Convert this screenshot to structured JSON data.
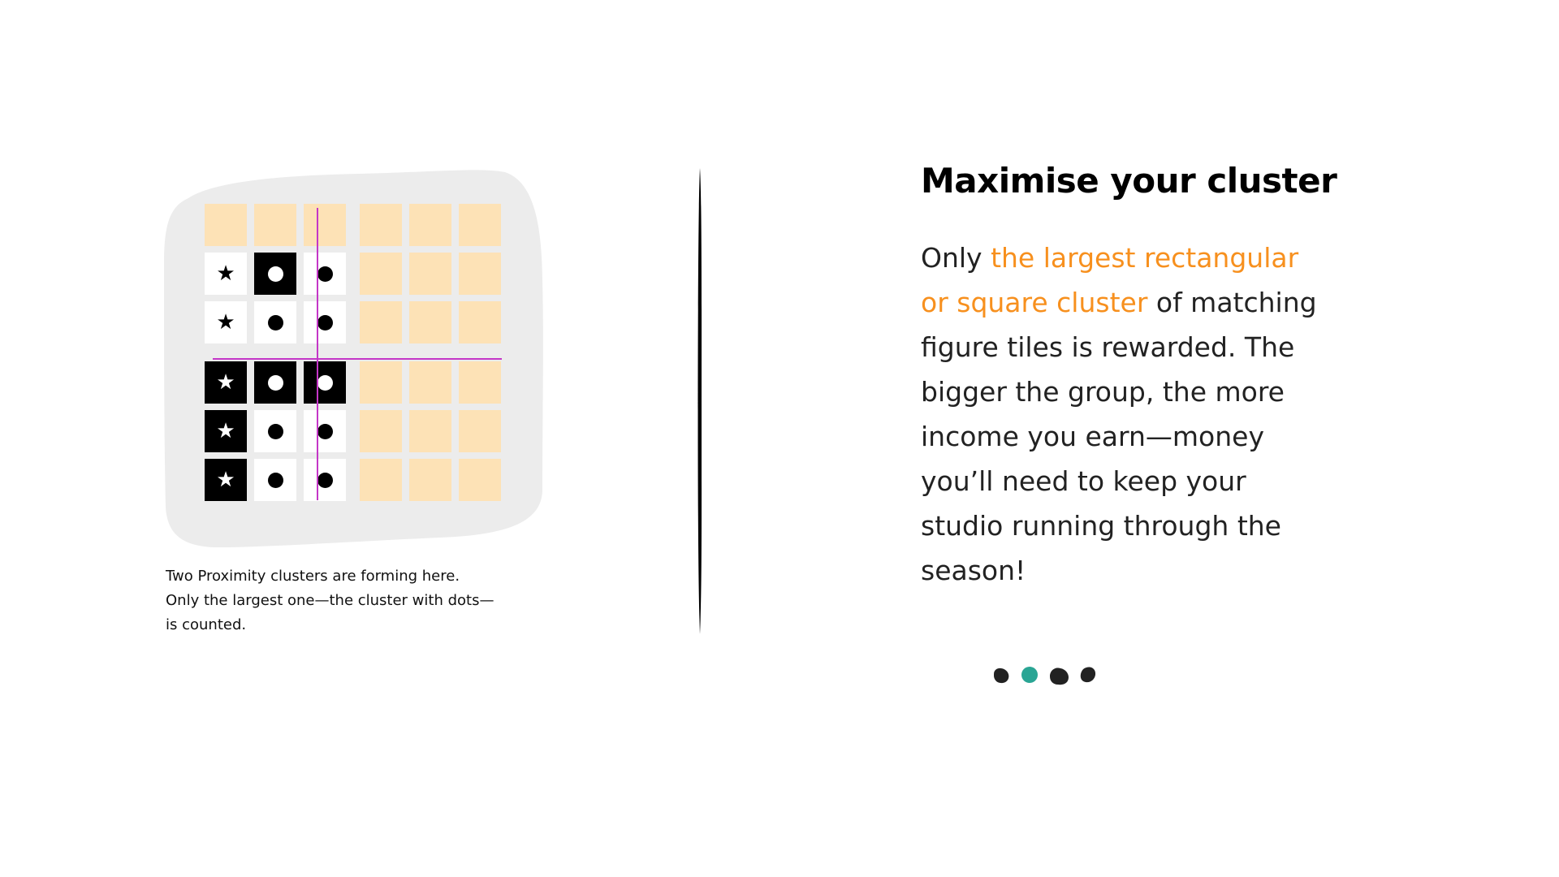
{
  "illustration": {
    "caption_lines": [
      "Two Proximity clusters are forming here.",
      "Only the largest one—the cluster with dots—",
      "is counted."
    ],
    "grid_rows": [
      [
        "empty",
        "empty",
        "empty",
        "empty",
        "empty",
        "empty"
      ],
      [
        "light-star",
        "dark-dot",
        "light-dot",
        "empty",
        "empty",
        "empty"
      ],
      [
        "light-star",
        "light-dot",
        "light-dot",
        "empty",
        "empty",
        "empty"
      ],
      [
        "dark-star",
        "dark-dot",
        "dark-dot",
        "empty",
        "empty",
        "empty"
      ],
      [
        "dark-star",
        "light-dot",
        "light-dot",
        "empty",
        "empty",
        "empty"
      ],
      [
        "dark-star",
        "light-dot",
        "light-dot",
        "empty",
        "empty",
        "empty"
      ]
    ],
    "colors": {
      "empty_tile": "#fde2b6",
      "backdrop": "#ececec",
      "divider_lines": "#c436c8"
    }
  },
  "content": {
    "heading": "Maximise your cluster",
    "body_intro": "Only ",
    "body_highlight": "the largest rectangular or square cluster",
    "body_rest": " of matching figure tiles is rewarded. The bigger the group, the more income you earn—money you’ll need to keep your studio running through the season!",
    "highlight_color": "#f7901e"
  },
  "pagination": {
    "total": 4,
    "active_index": 1,
    "active_color": "#2aa594",
    "inactive_color": "#222222"
  }
}
